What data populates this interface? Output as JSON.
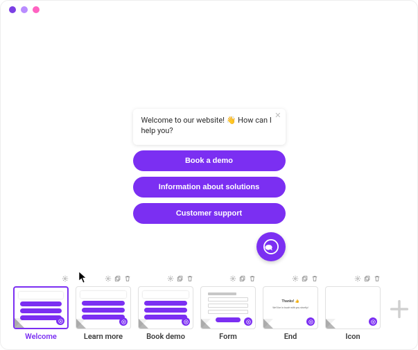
{
  "colors": {
    "accent": "#7b2ff2"
  },
  "chat": {
    "greeting": "Welcome to our website! 👋  How can I help you?",
    "buttons": [
      "Book a demo",
      "Information about solutions",
      "Customer support"
    ]
  },
  "screens": {
    "selected_index": 0,
    "items": [
      {
        "label": "Welcome"
      },
      {
        "label": "Learn more"
      },
      {
        "label": "Book demo"
      },
      {
        "label": "Form"
      },
      {
        "label": "End"
      },
      {
        "label": "Icon"
      }
    ],
    "end_preview": {
      "title": "Thanks! 👍",
      "subtitle": "We'll be in touch with you shortly!"
    }
  }
}
